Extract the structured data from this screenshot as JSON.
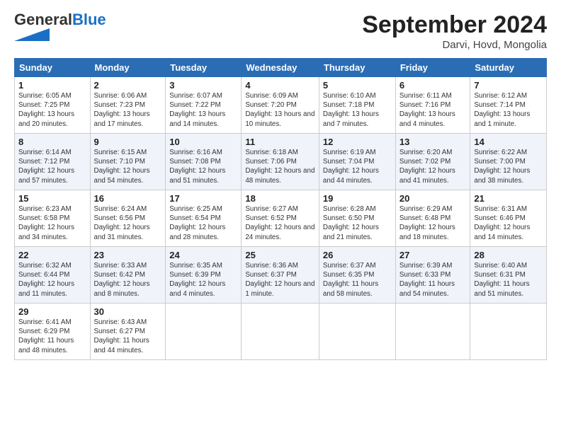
{
  "header": {
    "logo_general": "General",
    "logo_blue": "Blue",
    "month_title": "September 2024",
    "location": "Darvi, Hovd, Mongolia"
  },
  "days_of_week": [
    "Sunday",
    "Monday",
    "Tuesday",
    "Wednesday",
    "Thursday",
    "Friday",
    "Saturday"
  ],
  "weeks": [
    [
      {
        "day": 1,
        "sunrise": "6:05 AM",
        "sunset": "7:25 PM",
        "daylight": "13 hours and 20 minutes."
      },
      {
        "day": 2,
        "sunrise": "6:06 AM",
        "sunset": "7:23 PM",
        "daylight": "13 hours and 17 minutes."
      },
      {
        "day": 3,
        "sunrise": "6:07 AM",
        "sunset": "7:22 PM",
        "daylight": "13 hours and 14 minutes."
      },
      {
        "day": 4,
        "sunrise": "6:09 AM",
        "sunset": "7:20 PM",
        "daylight": "13 hours and 10 minutes."
      },
      {
        "day": 5,
        "sunrise": "6:10 AM",
        "sunset": "7:18 PM",
        "daylight": "13 hours and 7 minutes."
      },
      {
        "day": 6,
        "sunrise": "6:11 AM",
        "sunset": "7:16 PM",
        "daylight": "13 hours and 4 minutes."
      },
      {
        "day": 7,
        "sunrise": "6:12 AM",
        "sunset": "7:14 PM",
        "daylight": "13 hours and 1 minute."
      }
    ],
    [
      {
        "day": 8,
        "sunrise": "6:14 AM",
        "sunset": "7:12 PM",
        "daylight": "12 hours and 57 minutes."
      },
      {
        "day": 9,
        "sunrise": "6:15 AM",
        "sunset": "7:10 PM",
        "daylight": "12 hours and 54 minutes."
      },
      {
        "day": 10,
        "sunrise": "6:16 AM",
        "sunset": "7:08 PM",
        "daylight": "12 hours and 51 minutes."
      },
      {
        "day": 11,
        "sunrise": "6:18 AM",
        "sunset": "7:06 PM",
        "daylight": "12 hours and 48 minutes."
      },
      {
        "day": 12,
        "sunrise": "6:19 AM",
        "sunset": "7:04 PM",
        "daylight": "12 hours and 44 minutes."
      },
      {
        "day": 13,
        "sunrise": "6:20 AM",
        "sunset": "7:02 PM",
        "daylight": "12 hours and 41 minutes."
      },
      {
        "day": 14,
        "sunrise": "6:22 AM",
        "sunset": "7:00 PM",
        "daylight": "12 hours and 38 minutes."
      }
    ],
    [
      {
        "day": 15,
        "sunrise": "6:23 AM",
        "sunset": "6:58 PM",
        "daylight": "12 hours and 34 minutes."
      },
      {
        "day": 16,
        "sunrise": "6:24 AM",
        "sunset": "6:56 PM",
        "daylight": "12 hours and 31 minutes."
      },
      {
        "day": 17,
        "sunrise": "6:25 AM",
        "sunset": "6:54 PM",
        "daylight": "12 hours and 28 minutes."
      },
      {
        "day": 18,
        "sunrise": "6:27 AM",
        "sunset": "6:52 PM",
        "daylight": "12 hours and 24 minutes."
      },
      {
        "day": 19,
        "sunrise": "6:28 AM",
        "sunset": "6:50 PM",
        "daylight": "12 hours and 21 minutes."
      },
      {
        "day": 20,
        "sunrise": "6:29 AM",
        "sunset": "6:48 PM",
        "daylight": "12 hours and 18 minutes."
      },
      {
        "day": 21,
        "sunrise": "6:31 AM",
        "sunset": "6:46 PM",
        "daylight": "12 hours and 14 minutes."
      }
    ],
    [
      {
        "day": 22,
        "sunrise": "6:32 AM",
        "sunset": "6:44 PM",
        "daylight": "12 hours and 11 minutes."
      },
      {
        "day": 23,
        "sunrise": "6:33 AM",
        "sunset": "6:42 PM",
        "daylight": "12 hours and 8 minutes."
      },
      {
        "day": 24,
        "sunrise": "6:35 AM",
        "sunset": "6:39 PM",
        "daylight": "12 hours and 4 minutes."
      },
      {
        "day": 25,
        "sunrise": "6:36 AM",
        "sunset": "6:37 PM",
        "daylight": "12 hours and 1 minute."
      },
      {
        "day": 26,
        "sunrise": "6:37 AM",
        "sunset": "6:35 PM",
        "daylight": "11 hours and 58 minutes."
      },
      {
        "day": 27,
        "sunrise": "6:39 AM",
        "sunset": "6:33 PM",
        "daylight": "11 hours and 54 minutes."
      },
      {
        "day": 28,
        "sunrise": "6:40 AM",
        "sunset": "6:31 PM",
        "daylight": "11 hours and 51 minutes."
      }
    ],
    [
      {
        "day": 29,
        "sunrise": "6:41 AM",
        "sunset": "6:29 PM",
        "daylight": "11 hours and 48 minutes."
      },
      {
        "day": 30,
        "sunrise": "6:43 AM",
        "sunset": "6:27 PM",
        "daylight": "11 hours and 44 minutes."
      },
      null,
      null,
      null,
      null,
      null
    ]
  ]
}
